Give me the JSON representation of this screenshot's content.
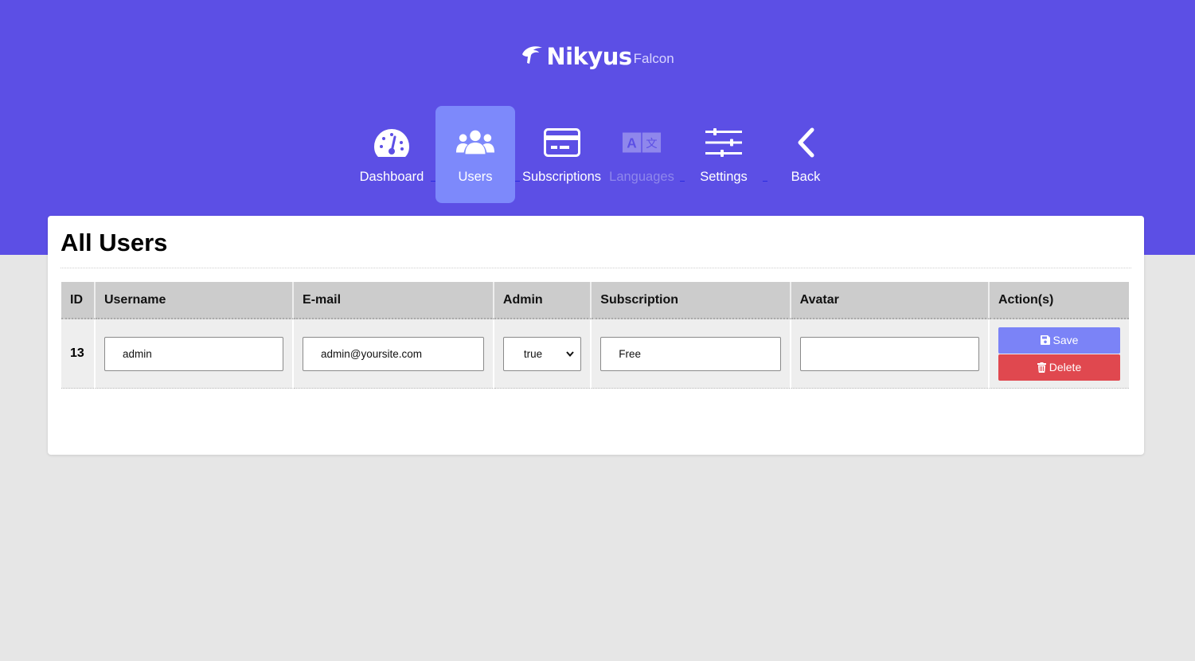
{
  "brand": {
    "name": "Nikyus",
    "sub": "Falcon"
  },
  "nav": [
    {
      "label": "Dashboard",
      "icon": "dashboard-gauge-icon",
      "state": "normal"
    },
    {
      "label": "Users",
      "icon": "users-icon",
      "state": "active"
    },
    {
      "label": "Subscriptions",
      "icon": "credit-card-icon",
      "state": "normal"
    },
    {
      "label": "Languages",
      "icon": "language-icon",
      "state": "disabled"
    },
    {
      "label": "Settings",
      "icon": "sliders-icon",
      "state": "normal"
    },
    {
      "label": "Back",
      "icon": "chevron-left-icon",
      "state": "normal"
    }
  ],
  "page": {
    "title": "All Users"
  },
  "table": {
    "headers": [
      "ID",
      "Username",
      "E-mail",
      "Admin",
      "Subscription",
      "Avatar",
      "Action(s)"
    ],
    "rows": [
      {
        "id": "13",
        "username": "admin",
        "email": "admin@yoursite.com",
        "admin": "true",
        "subscription": "Free",
        "avatar": "",
        "save_label": "Save",
        "delete_label": "Delete"
      }
    ]
  },
  "colors": {
    "header": "#5c4fe5",
    "active_nav": "#7d89fb",
    "save": "#7b83f7",
    "delete": "#e0484f",
    "background": "#e6e6e6"
  }
}
